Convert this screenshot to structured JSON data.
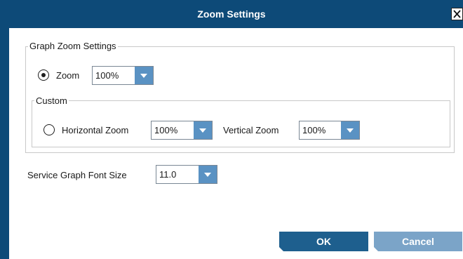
{
  "dialog": {
    "title": "Zoom Settings",
    "close_icon": "close-icon"
  },
  "graph_zoom": {
    "legend": "Graph Zoom Settings",
    "zoom_label": "Zoom",
    "zoom_value": "100%",
    "zoom_selected": true
  },
  "custom": {
    "legend": "Custom",
    "custom_selected": false,
    "horizontal_label": "Horizontal Zoom",
    "horizontal_value": "100%",
    "vertical_label": "Vertical Zoom",
    "vertical_value": "100%"
  },
  "font_size": {
    "label": "Service Graph Font Size",
    "value": "11.0"
  },
  "buttons": {
    "ok": "OK",
    "cancel": "Cancel"
  },
  "colors": {
    "titlebar": "#0d4a78",
    "dropdown_arrow": "#5a92c3",
    "ok_button": "#1e5f8e",
    "cancel_button": "#7ba4c8"
  }
}
